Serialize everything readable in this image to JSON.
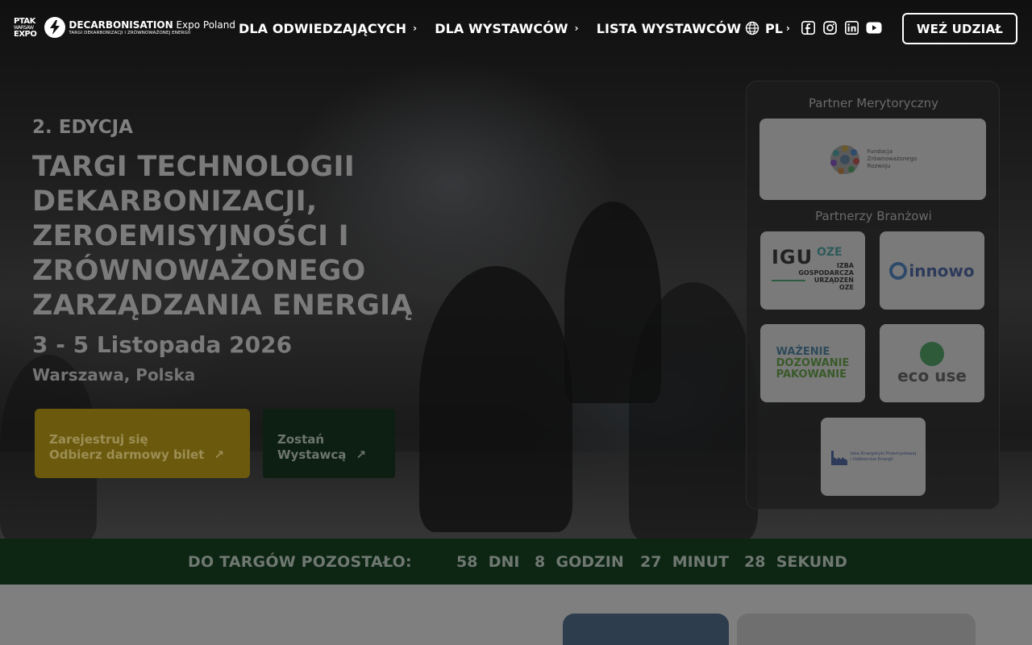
{
  "header": {
    "logo": {
      "ptak_line1": "PTAK",
      "ptak_line2": "WARSAW",
      "ptak_line3": "EXPO",
      "brand_bold": "DECARBONISATION",
      "brand_regular": "Expo Poland",
      "tagline": "TARGI DEKARBONIZACJI I ZRÓWNOWAŻONEJ ENERGII"
    },
    "nav": [
      {
        "label": "DLA ODWIEDZAJĄCYCH",
        "has_chevron": true
      },
      {
        "label": "DLA WYSTAWCÓW",
        "has_chevron": true
      },
      {
        "label": "LISTA WYSTAWCÓW",
        "has_chevron": false
      }
    ],
    "language": "PL",
    "socials": [
      "facebook-icon",
      "instagram-icon",
      "linkedin-icon",
      "youtube-icon"
    ],
    "cta": "WEŹ UDZIAŁ"
  },
  "hero": {
    "edition": "2. EDYCJA",
    "title": "TARGI TECHNOLOGII DEKARBONIZACJI, ZEROEMISYJNOŚCI I ZRÓWNOWAŻONEGO ZARZĄDZANIA ENERGIĄ",
    "date": "3 - 5 Listopada 2026",
    "location": "Warszawa, Polska",
    "register_line1": "Zarejestruj się",
    "register_line2": "Odbierz darmowy bilet",
    "exhibitor_line1": "Zostań",
    "exhibitor_line2": "Wystawcą"
  },
  "partners": {
    "substantive_heading": "Partner Merytoryczny",
    "industry_heading": "Partnerzy Branżowi",
    "substantive": {
      "line1": "Fundacja",
      "line2": "Zrównoważonego",
      "line3": "Rozwoju"
    },
    "igu": {
      "mark": "IGU",
      "oze": "OZE",
      "line1": "IZBA",
      "line2": "GOSPODARCZA",
      "line3": "URZĄDZEŃ",
      "line4": "OZE"
    },
    "innowo": "innowo",
    "wazenie": {
      "line1": "WAŻENIE",
      "line2": "DOZOWANIE",
      "line3": "PAKOWANIE"
    },
    "ecouse": "eco use",
    "izba": {
      "line1": "Izba Energetyki Przemysłowej",
      "line2": "i Odbiorców Energii"
    }
  },
  "countdown": {
    "label": "DO TARGÓW POZOSTAŁO:",
    "days": "58",
    "days_unit": "DNI",
    "hours": "8",
    "hours_unit": "GODZIN",
    "minutes": "27",
    "minutes_unit": "MINUT",
    "seconds": "28",
    "seconds_unit": "SEKUND"
  },
  "colors": {
    "register_button": "#6b5a0d",
    "exhibitor_button": "#0c1f12",
    "countdown_bar": "#0d2513"
  }
}
